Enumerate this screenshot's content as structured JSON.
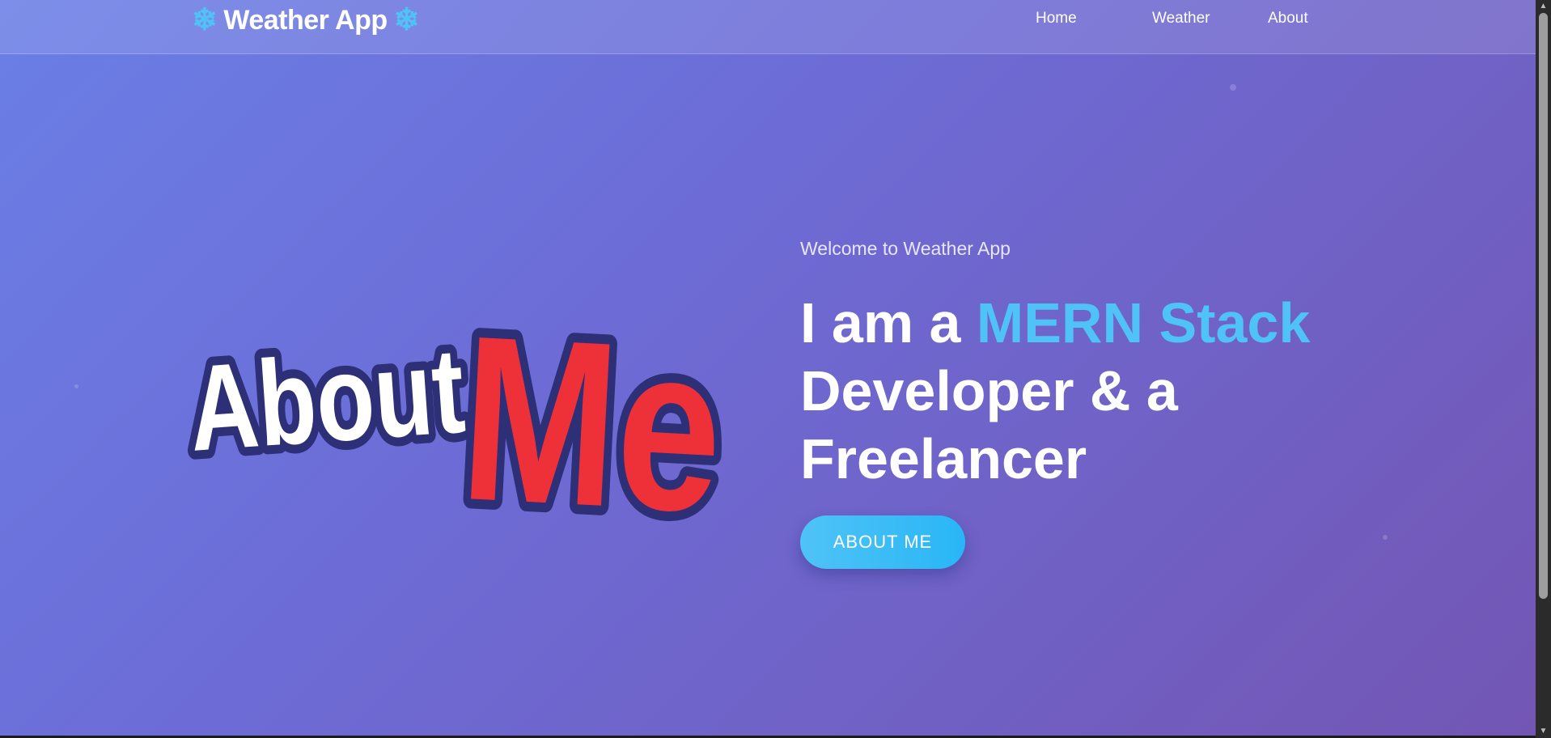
{
  "navbar": {
    "brand": {
      "text": "Weather App",
      "icon_left": "snowflake-icon",
      "icon_right": "snowflake-icon"
    },
    "links": [
      {
        "label": "Home"
      },
      {
        "label": "Weather"
      },
      {
        "label": "About"
      }
    ]
  },
  "hero": {
    "logo": {
      "word1": "About",
      "word2": "Me"
    },
    "welcome": "Welcome to Weather App",
    "headline": {
      "part1": "I am a ",
      "accent": "MERN Stack",
      "part2": "Developer & a",
      "part3": "Freelancer"
    },
    "cta_label": "ABOUT ME"
  },
  "colors": {
    "accent": "#4fc3f7",
    "logo_red": "#ee3139",
    "logo_outline": "#2d2f77",
    "gradient_start": "#6a7fe6",
    "gradient_end": "#7356b4"
  }
}
